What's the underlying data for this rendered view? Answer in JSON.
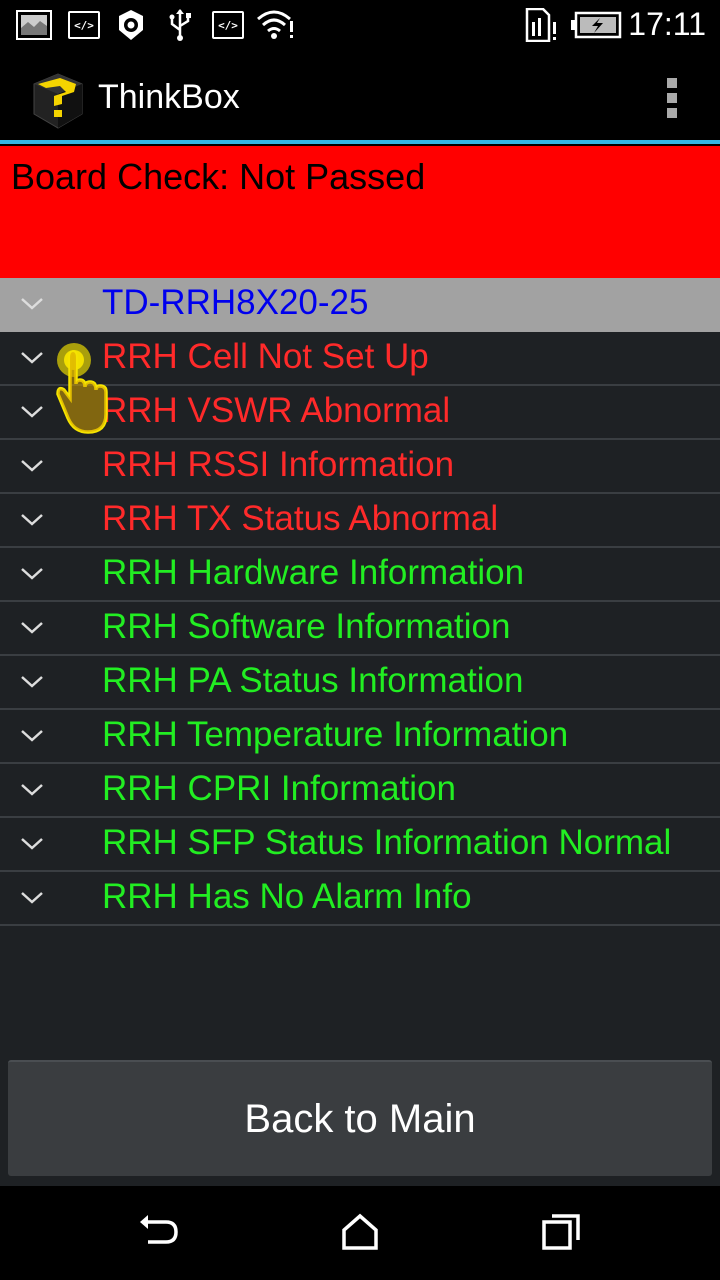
{
  "status_bar": {
    "time": "17:11",
    "icons": [
      "image-icon",
      "code-icon",
      "settings-icon",
      "usb-icon",
      "code-icon",
      "wifi-icon",
      "sim-alert-icon",
      "battery-charging-icon"
    ]
  },
  "app": {
    "title": "ThinkBox",
    "logo_icon": "thinkbox-logo-icon",
    "overflow_icon": "overflow-menu-icon"
  },
  "board_check": {
    "text": "Board Check: Not Passed",
    "color": "#ff0000"
  },
  "device": {
    "name": "TD-RRH8X20-25",
    "color": "#0000ee"
  },
  "items": [
    {
      "label": "RRH Cell Not Set Up",
      "color": "#ff2a2a"
    },
    {
      "label": "RRH VSWR Abnormal",
      "color": "#ff2a2a"
    },
    {
      "label": "RRH RSSI Information",
      "color": "#ff2a2a"
    },
    {
      "label": "RRH TX Status Abnormal",
      "color": "#ff2a2a"
    },
    {
      "label": "RRH Hardware Information",
      "color": "#22ee22"
    },
    {
      "label": "RRH Software Information",
      "color": "#22ee22"
    },
    {
      "label": "RRH PA Status Information",
      "color": "#22ee22"
    },
    {
      "label": "RRH Temperature Information",
      "color": "#22ee22"
    },
    {
      "label": "RRH CPRI Information",
      "color": "#22ee22"
    },
    {
      "label": "RRH SFP Status Information Normal",
      "color": "#22ee22"
    },
    {
      "label": "RRH Has No Alarm Info",
      "color": "#22ee22"
    }
  ],
  "back_button": {
    "label": "Back to Main"
  },
  "nav": {
    "back_icon": "back-icon",
    "home_icon": "home-icon",
    "recents_icon": "recents-icon"
  }
}
